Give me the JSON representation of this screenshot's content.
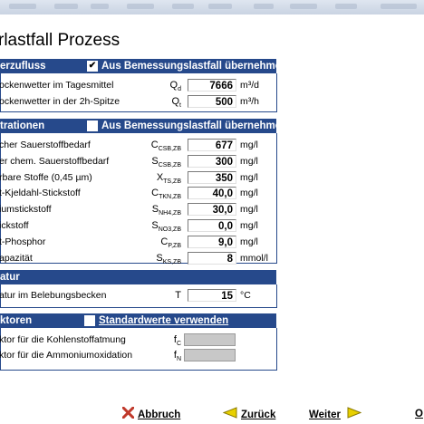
{
  "title": "rlastfall Prozess",
  "sections": {
    "zufluss": {
      "title": "erzufluss",
      "checkbox_label": "Aus Bemessungslastfall übernehmen",
      "checked": true,
      "rows": [
        {
          "label": "ockenwetter im Tagesmittel",
          "symbol": "Q",
          "sub": "d",
          "value": "7666",
          "unit": "m³/d"
        },
        {
          "label": "ockenwetter in der 2h-Spitze",
          "symbol": "Q",
          "sub": "t",
          "value": "500",
          "unit": "m³/h"
        }
      ]
    },
    "konz": {
      "title": "trationen",
      "checkbox_label": "Aus Bemessungslastfall übernehmen",
      "checked": false,
      "rows": [
        {
          "label": "cher Sauerstoffbedarf",
          "symbol": "C",
          "sub": "CSB,ZB",
          "value": "677",
          "unit": "mg/l"
        },
        {
          "label": "er chem. Sauerstoffbedarf",
          "symbol": "S",
          "sub": "CSB,ZB",
          "value": "300",
          "unit": "mg/l"
        },
        {
          "label": "rbare Stoffe (0,45 µm)",
          "symbol": "X",
          "sub": "TS,ZB",
          "value": "350",
          "unit": "mg/l"
        },
        {
          "label": "t-Kjeldahl-Stickstoff",
          "symbol": "C",
          "sub": "TKN,ZB",
          "value": "40,0",
          "unit": "mg/l"
        },
        {
          "label": "iumstickstoff",
          "symbol": "S",
          "sub": "NH4,ZB",
          "value": "30,0",
          "unit": "mg/l"
        },
        {
          "label": "ickstoff",
          "symbol": "S",
          "sub": "NO3,ZB",
          "value": "0,0",
          "unit": "mg/l"
        },
        {
          "label": "t-Phosphor",
          "symbol": "C",
          "sub": "P,ZB",
          "value": "9,0",
          "unit": "mg/l"
        },
        {
          "label": "apazität",
          "symbol": "S",
          "sub": "KS,ZB",
          "value": "8",
          "unit": "mmol/l"
        }
      ]
    },
    "temp": {
      "title": "atur",
      "rows": [
        {
          "label": "atur im Belebungsbecken",
          "symbol": "T",
          "sub": "",
          "value": "15",
          "unit": "°C"
        }
      ]
    },
    "faktoren": {
      "title": "ktoren",
      "checkbox_label": "Standardwerte verwenden",
      "checked": false,
      "rows": [
        {
          "label": "ktor für die Kohlenstoffatmung",
          "symbol": "f",
          "sub": "C",
          "value": "",
          "unit": ""
        },
        {
          "label": "ktor für die Ammoniumoxidation",
          "symbol": "f",
          "sub": "N",
          "value": "",
          "unit": ""
        }
      ]
    }
  },
  "buttons": {
    "abbruch": "Abbruch",
    "zurueck": "Zurück",
    "weiter": "Weiter",
    "ok": "O"
  },
  "colors": {
    "header_bg": "#26498b",
    "abbruch_icon": "#c0392b",
    "arrow_icon": "#e8d000"
  }
}
